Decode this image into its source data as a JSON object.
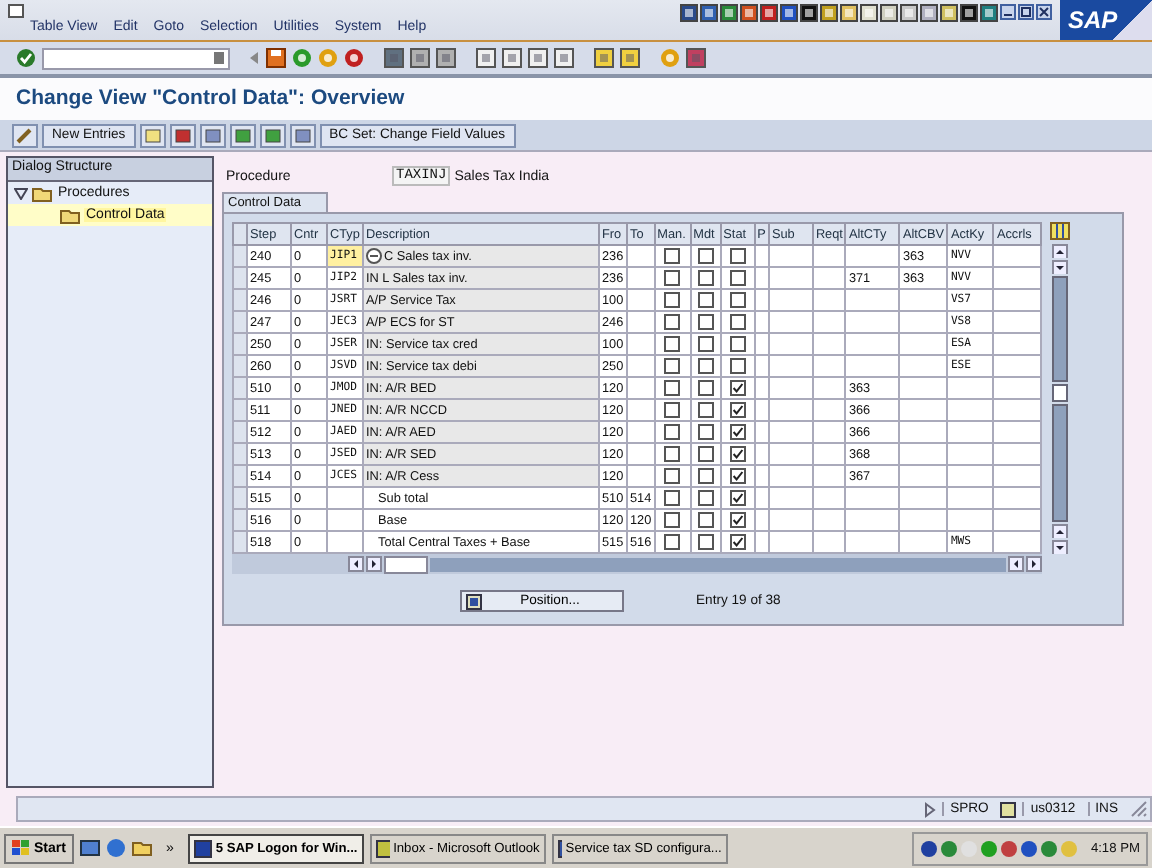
{
  "menu": [
    "Table View",
    "Edit",
    "Goto",
    "Selection",
    "Utilities",
    "System",
    "Help"
  ],
  "logo": "SAP",
  "title": "Change View \"Control Data\": Overview",
  "app_toolbar": {
    "new_entries": "New Entries",
    "bc_set": "BC Set: Change Field Values"
  },
  "dialog_structure": {
    "title": "Dialog Structure",
    "items": [
      {
        "label": "Procedures",
        "expanded": true,
        "selected": false,
        "children": [
          {
            "label": "Control Data",
            "selected": true
          }
        ]
      }
    ]
  },
  "procedure": {
    "label": "Procedure",
    "value": "TAXINJ",
    "text": "Sales Tax India"
  },
  "tab": "Control Data",
  "table": {
    "columns": [
      "Step",
      "Cntr",
      "CTyp",
      "Description",
      "Fro",
      "To",
      "Man.",
      "Mdt",
      "Stat",
      "P",
      "Sub",
      "Reqt",
      "AltCTy",
      "AltCBV",
      "ActKy",
      "Accrls"
    ],
    "rows": [
      {
        "step": "240",
        "counter": "0",
        "condition_type": "JIP1",
        "description": "C Sales tax inv.",
        "from": "236",
        "manual": false,
        "mandatory": false,
        "statistical": false,
        "alt_base_value": "363",
        "account_key": "NVV",
        "kind": "condition",
        "focused": true
      },
      {
        "step": "245",
        "counter": "0",
        "condition_type": "JIP2",
        "description": "IN L Sales tax inv.",
        "from": "236",
        "manual": false,
        "mandatory": false,
        "statistical": false,
        "alt_calc_type": "371",
        "alt_base_value": "363",
        "account_key": "NVV",
        "kind": "condition",
        "focused": false
      },
      {
        "step": "246",
        "counter": "0",
        "condition_type": "JSRT",
        "description": "A/P Service Tax",
        "from": "100",
        "manual": false,
        "mandatory": false,
        "statistical": false,
        "account_key": "VS7",
        "kind": "condition",
        "focused": false
      },
      {
        "step": "247",
        "counter": "0",
        "condition_type": "JEC3",
        "description": "A/P ECS for ST",
        "from": "246",
        "manual": false,
        "mandatory": false,
        "statistical": false,
        "account_key": "VS8",
        "kind": "condition",
        "focused": false
      },
      {
        "step": "250",
        "counter": "0",
        "condition_type": "JSER",
        "description": "IN: Service tax cred",
        "from": "100",
        "manual": false,
        "mandatory": false,
        "statistical": false,
        "account_key": "ESA",
        "kind": "condition",
        "focused": false
      },
      {
        "step": "260",
        "counter": "0",
        "condition_type": "JSVD",
        "description": "IN: Service tax debi",
        "from": "250",
        "manual": false,
        "mandatory": false,
        "statistical": false,
        "account_key": "ESE",
        "kind": "condition",
        "focused": false
      },
      {
        "step": "510",
        "counter": "0",
        "condition_type": "JMOD",
        "description": "IN: A/R BED",
        "from": "120",
        "manual": false,
        "mandatory": false,
        "statistical": true,
        "alt_calc_type": "363",
        "kind": "condition",
        "focused": false
      },
      {
        "step": "511",
        "counter": "0",
        "condition_type": "JNED",
        "description": "IN: A/R NCCD",
        "from": "120",
        "manual": false,
        "mandatory": false,
        "statistical": true,
        "alt_calc_type": "366",
        "kind": "condition",
        "focused": false
      },
      {
        "step": "512",
        "counter": "0",
        "condition_type": "JAED",
        "description": "IN: A/R AED",
        "from": "120",
        "manual": false,
        "mandatory": false,
        "statistical": true,
        "alt_calc_type": "366",
        "kind": "condition",
        "focused": false
      },
      {
        "step": "513",
        "counter": "0",
        "condition_type": "JSED",
        "description": "IN: A/R SED",
        "from": "120",
        "manual": false,
        "mandatory": false,
        "statistical": true,
        "alt_calc_type": "368",
        "kind": "condition",
        "focused": false
      },
      {
        "step": "514",
        "counter": "0",
        "condition_type": "JCES",
        "description": "IN: A/R Cess",
        "from": "120",
        "manual": false,
        "mandatory": false,
        "statistical": true,
        "alt_calc_type": "367",
        "kind": "condition",
        "focused": false
      },
      {
        "step": "515",
        "counter": "0",
        "description": "Sub total",
        "from": "510",
        "to": "514",
        "manual": false,
        "mandatory": false,
        "statistical": true,
        "kind": "total",
        "focused": false
      },
      {
        "step": "516",
        "counter": "0",
        "description": "Base",
        "from": "120",
        "to": "120",
        "manual": false,
        "mandatory": false,
        "statistical": true,
        "kind": "total",
        "focused": false
      },
      {
        "step": "518",
        "counter": "0",
        "description": "Total Central Taxes + Base",
        "from": "515",
        "to": "516",
        "manual": false,
        "mandatory": false,
        "statistical": true,
        "account_key": "MWS",
        "kind": "total",
        "focused": false
      }
    ]
  },
  "position_button": "Position...",
  "entry_info": "Entry 19 of 38",
  "status_bar": {
    "transaction": "SPRO",
    "server": "us0312",
    "mode": "INS"
  },
  "taskbar": {
    "start": "Start",
    "more": "»",
    "tasks": [
      {
        "label": "5 SAP Logon for Win...",
        "selected": true
      },
      {
        "label": "Inbox - Microsoft Outlook",
        "selected": false
      },
      {
        "label": "Service tax SD configura...",
        "selected": false
      }
    ],
    "time": "4:18 PM"
  }
}
